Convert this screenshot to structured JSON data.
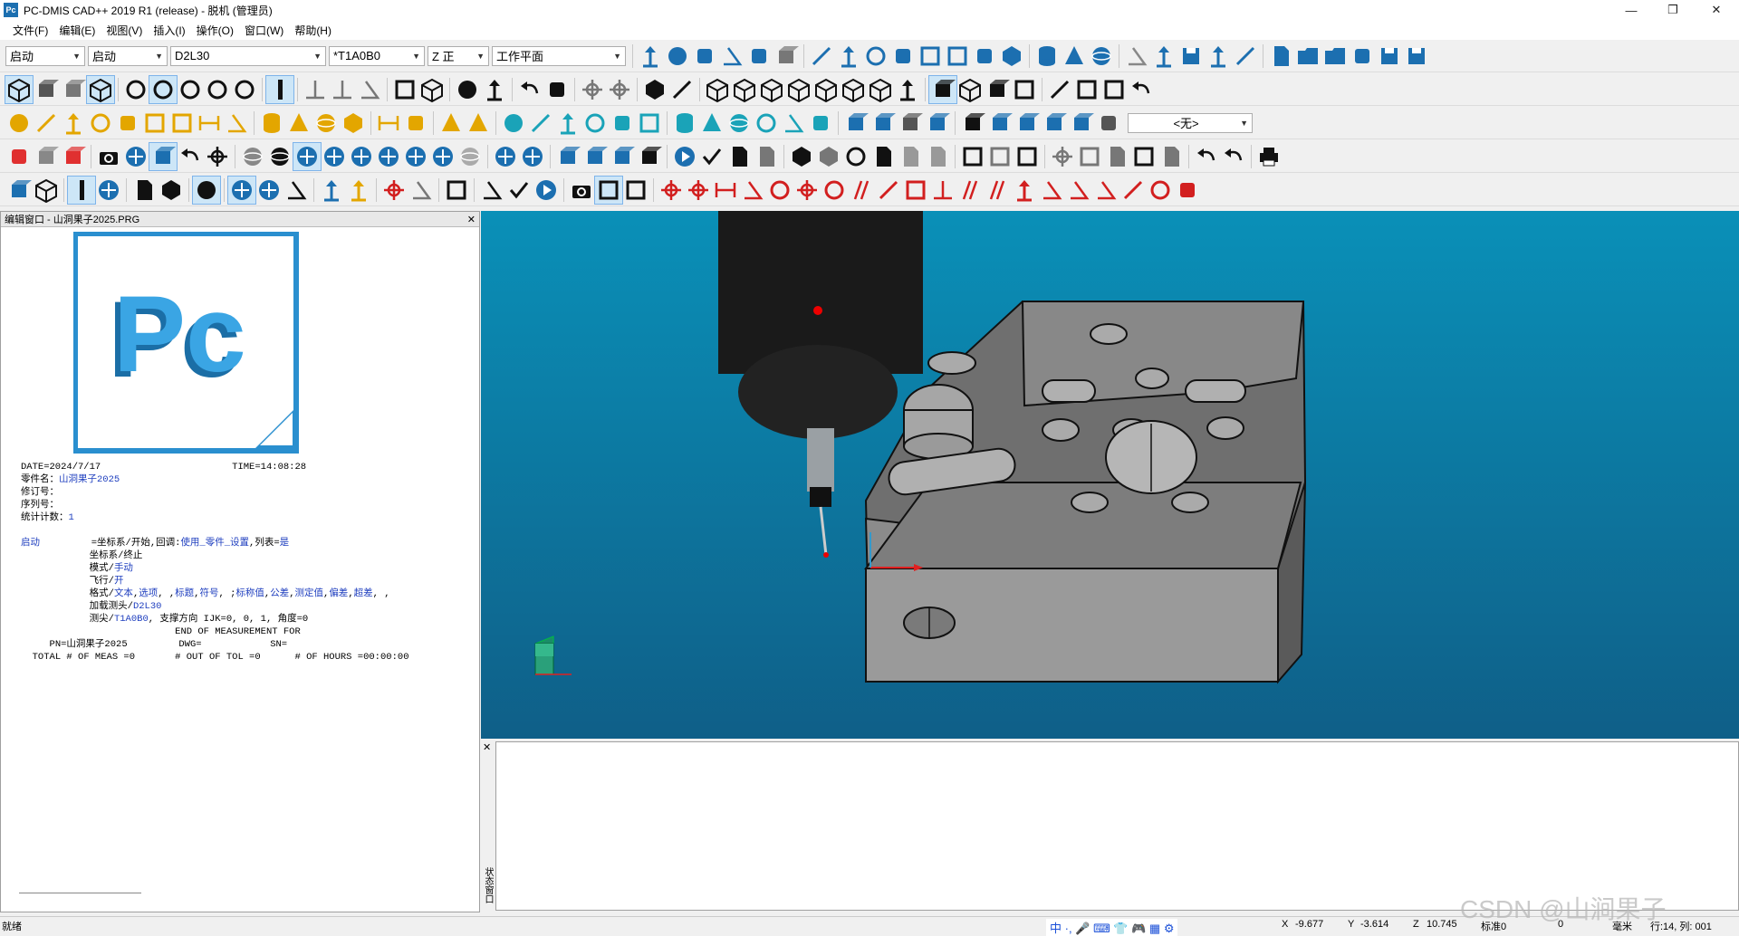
{
  "window": {
    "title": "PC-DMIS CAD++ 2019 R1 (release) - 脱机 (管理员)",
    "app_icon_text": "Pc",
    "minimize": "—",
    "restore": "❐",
    "close": "✕"
  },
  "menu": [
    "文件(F)",
    "编辑(E)",
    "视图(V)",
    "插入(I)",
    "操作(O)",
    "窗口(W)",
    "帮助(H)"
  ],
  "toolbar1": {
    "combos": [
      "启动",
      "启动",
      "D2L30",
      "*T1A0B0",
      "Z 正",
      "工作平面"
    ]
  },
  "toolbar3": {
    "combo_value": "<无>"
  },
  "edit_window": {
    "title": "编辑窗口 - 山洞果子2025.PRG",
    "close": "✕",
    "logo_text": "Pc",
    "report": {
      "date": "DATE=2024/7/17",
      "time": "TIME=14:08:28",
      "part_label": "零件名：",
      "part_name": "山洞果子2025",
      "revision": "修订号：",
      "serial": "序列号：",
      "stat_label": "统计计数：",
      "stat_value": "1",
      "start_label": "启动",
      "align_line_a": "=坐标系/开始,回调:",
      "align_line_b": "使用_零件_设置",
      "align_line_c": ",列表=",
      "align_line_d": "是",
      "align_end": "坐标系/终止",
      "mode_a": "模式/",
      "mode_b": "手动",
      "fly_a": "飞行/",
      "fly_b": "开",
      "format_a": "格式/",
      "format_b": "文本",
      "format_c": ",",
      "format_d": "选项",
      "format_e": ", ,",
      "format_f": "标题",
      "format_g": ",",
      "format_h": "符号",
      "format_i": ", ;",
      "format_j": "标称值",
      "format_k": ",",
      "format_l": "公差",
      "format_m": ",",
      "format_n": "测定值",
      "format_o": ",",
      "format_p": "偏差",
      "format_q": ",",
      "format_r": "超差",
      "format_s": ", ,",
      "loadprobe_a": "加载测头/",
      "loadprobe_b": "D2L30",
      "tip_a": "测尖/",
      "tip_b": "T1A0B0",
      "tip_c": ", 支撑方向 IJK=0, 0, 1, 角度=0",
      "end_line": "END OF MEASUREMENT FOR",
      "pn_line": "PN=山洞果子2025",
      "dwg": "DWG=",
      "sn": "SN=",
      "total": "TOTAL # OF MEAS =0",
      "out_tol": "# OUT OF TOL =0",
      "hours": "# OF HOURS =00:00:00"
    }
  },
  "status_window": {
    "title": "状态窗口",
    "close": "✕"
  },
  "statusbar": {
    "ready": "就绪",
    "x_label": "X",
    "x_value": "-9.677",
    "y_label": "Y",
    "y_value": "-3.614",
    "z_label": "Z",
    "z_value": "10.745",
    "standard": "标准0",
    "zero": "0",
    "unit": "毫米",
    "row_col": "行:14, 列: 001",
    "ime": "中 ·, 🎤 ⌨ 👕 🎮 ▦ ⚙",
    "watermark": "CSDN @山涧果子"
  },
  "colors": {
    "toolbar_icon": "#1c6fb0",
    "feature_icon": "#e3a600",
    "dimension_icon": "#d21f1f",
    "viewport_top": "#0a90b8",
    "viewport_bottom": "#0f5f88",
    "part_gray": "#8a8a8a"
  }
}
